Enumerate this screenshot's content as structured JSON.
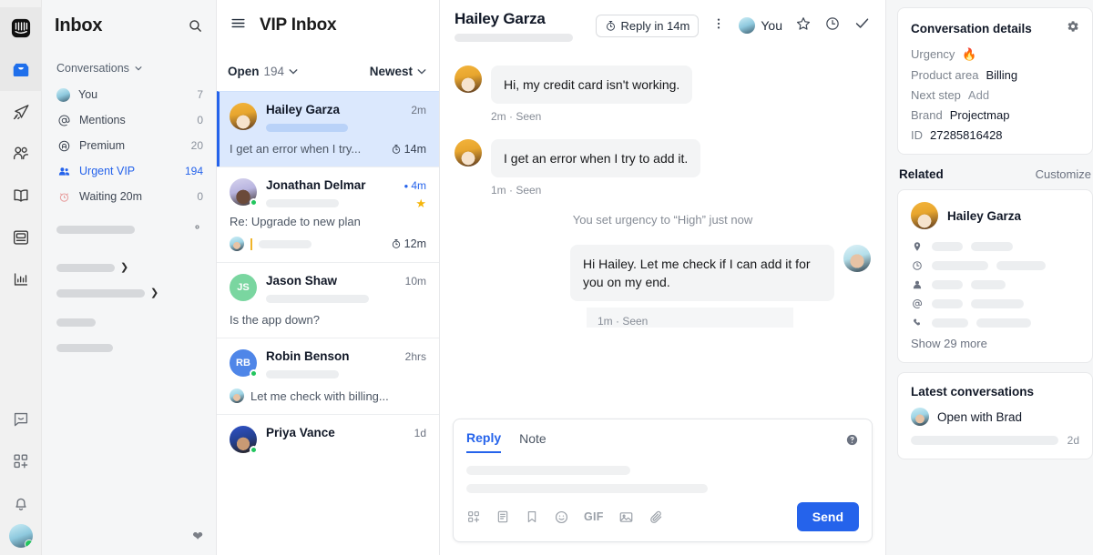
{
  "rail": {
    "items": [
      {
        "name": "logo",
        "icon": "intercom-logo-icon"
      },
      {
        "name": "inbox",
        "icon": "inbox-icon"
      },
      {
        "name": "outbound",
        "icon": "paper-plane-icon"
      },
      {
        "name": "contacts",
        "icon": "people-icon"
      },
      {
        "name": "knowledge",
        "icon": "book-icon"
      },
      {
        "name": "articles",
        "icon": "article-icon"
      },
      {
        "name": "reports",
        "icon": "bar-chart-icon"
      },
      {
        "name": "messenger",
        "icon": "chat-bubble-icon"
      },
      {
        "name": "apps",
        "icon": "apps-plus-icon"
      },
      {
        "name": "notifications",
        "icon": "bell-icon"
      }
    ]
  },
  "sidebar": {
    "title": "Inbox",
    "search_icon": "search-icon",
    "group_label": "Conversations",
    "items": [
      {
        "label": "You",
        "count": "7",
        "icon": "avatar",
        "active": false
      },
      {
        "label": "Mentions",
        "count": "0",
        "icon": "at-icon",
        "active": false
      },
      {
        "label": "Premium",
        "count": "20",
        "icon": "circle-a-icon",
        "active": false
      },
      {
        "label": "Urgent VIP",
        "count": "194",
        "icon": "vip-people-icon",
        "active": true
      },
      {
        "label": "Waiting 20m",
        "count": "0",
        "icon": "alarm-clock-icon",
        "active": false
      }
    ],
    "gear_icon": "gear-icon",
    "heart_icon": "heart-icon"
  },
  "conversation_list": {
    "menu_icon": "hamburger-menu-icon",
    "title": "VIP Inbox",
    "filter_status": "Open",
    "filter_count": "194",
    "sort_label": "Newest",
    "items": [
      {
        "name": "Hailey Garza",
        "time": "2m",
        "preview": "I get an error when I try...",
        "sla": "14m",
        "selected": true,
        "unread": false,
        "starred": false,
        "online": false,
        "avatar_kind": "photo-hailey",
        "initials": ""
      },
      {
        "name": "Jonathan Delmar",
        "time": "4m",
        "preview": "Re: Upgrade to new plan",
        "sla": "12m",
        "selected": false,
        "unread": true,
        "starred": true,
        "online": true,
        "avatar_kind": "photo-jonathan",
        "initials": "",
        "has_draft_row": true
      },
      {
        "name": "Jason Shaw",
        "time": "10m",
        "preview": "Is the app down?",
        "sla": "",
        "selected": false,
        "unread": false,
        "starred": false,
        "online": false,
        "avatar_kind": "initials-green",
        "initials": "JS"
      },
      {
        "name": "Robin Benson",
        "time": "2hrs",
        "preview": "Let me check with billing...",
        "sla": "",
        "selected": false,
        "unread": false,
        "starred": false,
        "online": true,
        "avatar_kind": "initials-blue",
        "initials": "RB",
        "preview_avatar": true
      },
      {
        "name": "Priya Vance",
        "time": "1d",
        "preview": "",
        "sla": "",
        "selected": false,
        "unread": false,
        "starred": false,
        "online": true,
        "avatar_kind": "photo-priya",
        "initials": ""
      }
    ]
  },
  "main": {
    "header": {
      "name": "Hailey Garza",
      "sla_badge": "Reply in 14m",
      "sla_icon": "stopwatch-icon",
      "more_icon": "more-vertical-icon",
      "assignee": "You",
      "star_icon": "star-outline-icon",
      "snooze_icon": "clock-icon",
      "close_icon": "check-icon"
    },
    "messages": [
      {
        "direction": "in",
        "text": "Hi, my credit card isn't working.",
        "meta": "2m · Seen",
        "avatar_kind": "photo-hailey"
      },
      {
        "direction": "in",
        "text": "I get an error when I try to add it.",
        "meta": "1m · Seen",
        "avatar_kind": "photo-hailey"
      },
      {
        "direction": "system",
        "text": "You set urgency to “High” just now"
      },
      {
        "direction": "out",
        "text": "Hi Hailey. Let me check if I can add it for you on my end.",
        "meta": "1m · Seen",
        "avatar_kind": "photo-agent"
      }
    ],
    "composer": {
      "tab_reply": "Reply",
      "tab_note": "Note",
      "help_icon": "help-circle-icon",
      "toolbar": [
        {
          "name": "apps-plus-icon",
          "label": ""
        },
        {
          "name": "article-icon",
          "label": ""
        },
        {
          "name": "saved-reply-icon",
          "label": ""
        },
        {
          "name": "emoji-icon",
          "label": ""
        },
        {
          "name": "gif-icon",
          "label": "GIF"
        },
        {
          "name": "image-icon",
          "label": ""
        },
        {
          "name": "attachment-icon",
          "label": ""
        }
      ],
      "send_label": "Send"
    }
  },
  "right_panel": {
    "details": {
      "title": "Conversation details",
      "gear_icon": "gear-icon",
      "attributes": [
        {
          "key": "Urgency",
          "value": "🔥"
        },
        {
          "key": "Product area",
          "value": "Billing"
        },
        {
          "key": "Next step",
          "value": "Add",
          "muted": true
        },
        {
          "key": "Brand",
          "value": "Projectmap"
        },
        {
          "key": "ID",
          "value": "27285816428"
        }
      ]
    },
    "related": {
      "title": "Related",
      "customize_label": "Customize",
      "person_name": "Hailey Garza",
      "attribute_icons": [
        "location-pin-icon",
        "clock-icon",
        "person-icon",
        "at-icon",
        "phone-icon"
      ],
      "show_more": "Show 29 more"
    },
    "latest": {
      "title": "Latest conversations",
      "item_label": "Open with Brad",
      "item_time": "2d"
    }
  },
  "colors": {
    "accent": "#2563eb",
    "selected_row_bg": "#dbe8fd",
    "page_bg": "#f5f6f7",
    "panel_bg": "#ffffff",
    "bubble_bg": "#f3f4f5",
    "star": "#f5b50a",
    "online": "#22c55e"
  }
}
